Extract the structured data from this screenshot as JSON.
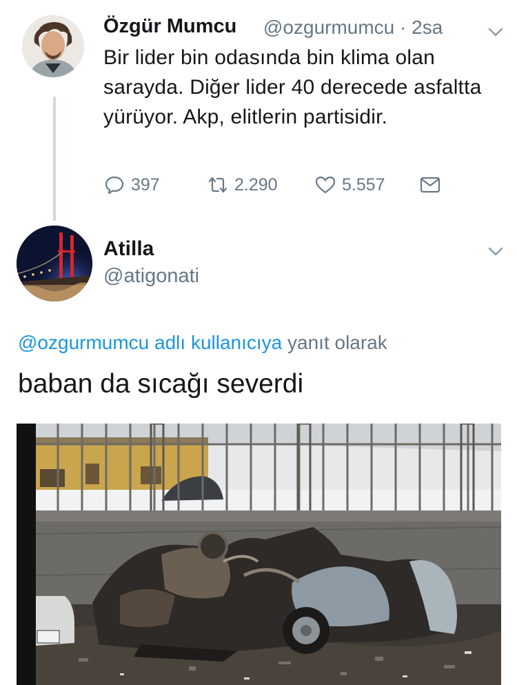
{
  "tweet": {
    "name": "Özgür Mumcu",
    "handle": "@ozgurmumcu",
    "time": "· 2sa",
    "text": "Bir lider bin odasında bin klima olan sarayda. Diğer lider 40 derecede asfaltta yürüyor. Akp, elitlerin partisidir.",
    "replies": "397",
    "retweets": "2.290",
    "likes": "5.557",
    "icons": [
      "reply-icon",
      "retweet-icon",
      "like-icon",
      "message-icon",
      "chevron-down-icon"
    ]
  },
  "reply": {
    "name": "Atilla",
    "handle": "@atigonati",
    "replying_mention": "@ozgurmumcu adlı kullanıcıya",
    "replying_suffix": " yanıt olarak",
    "text": "baban da sıcağı severdi"
  },
  "colors": {
    "text": "#14171a",
    "secondary": "#657786",
    "link": "#1b95e0",
    "thread_line": "#cfd9de"
  }
}
